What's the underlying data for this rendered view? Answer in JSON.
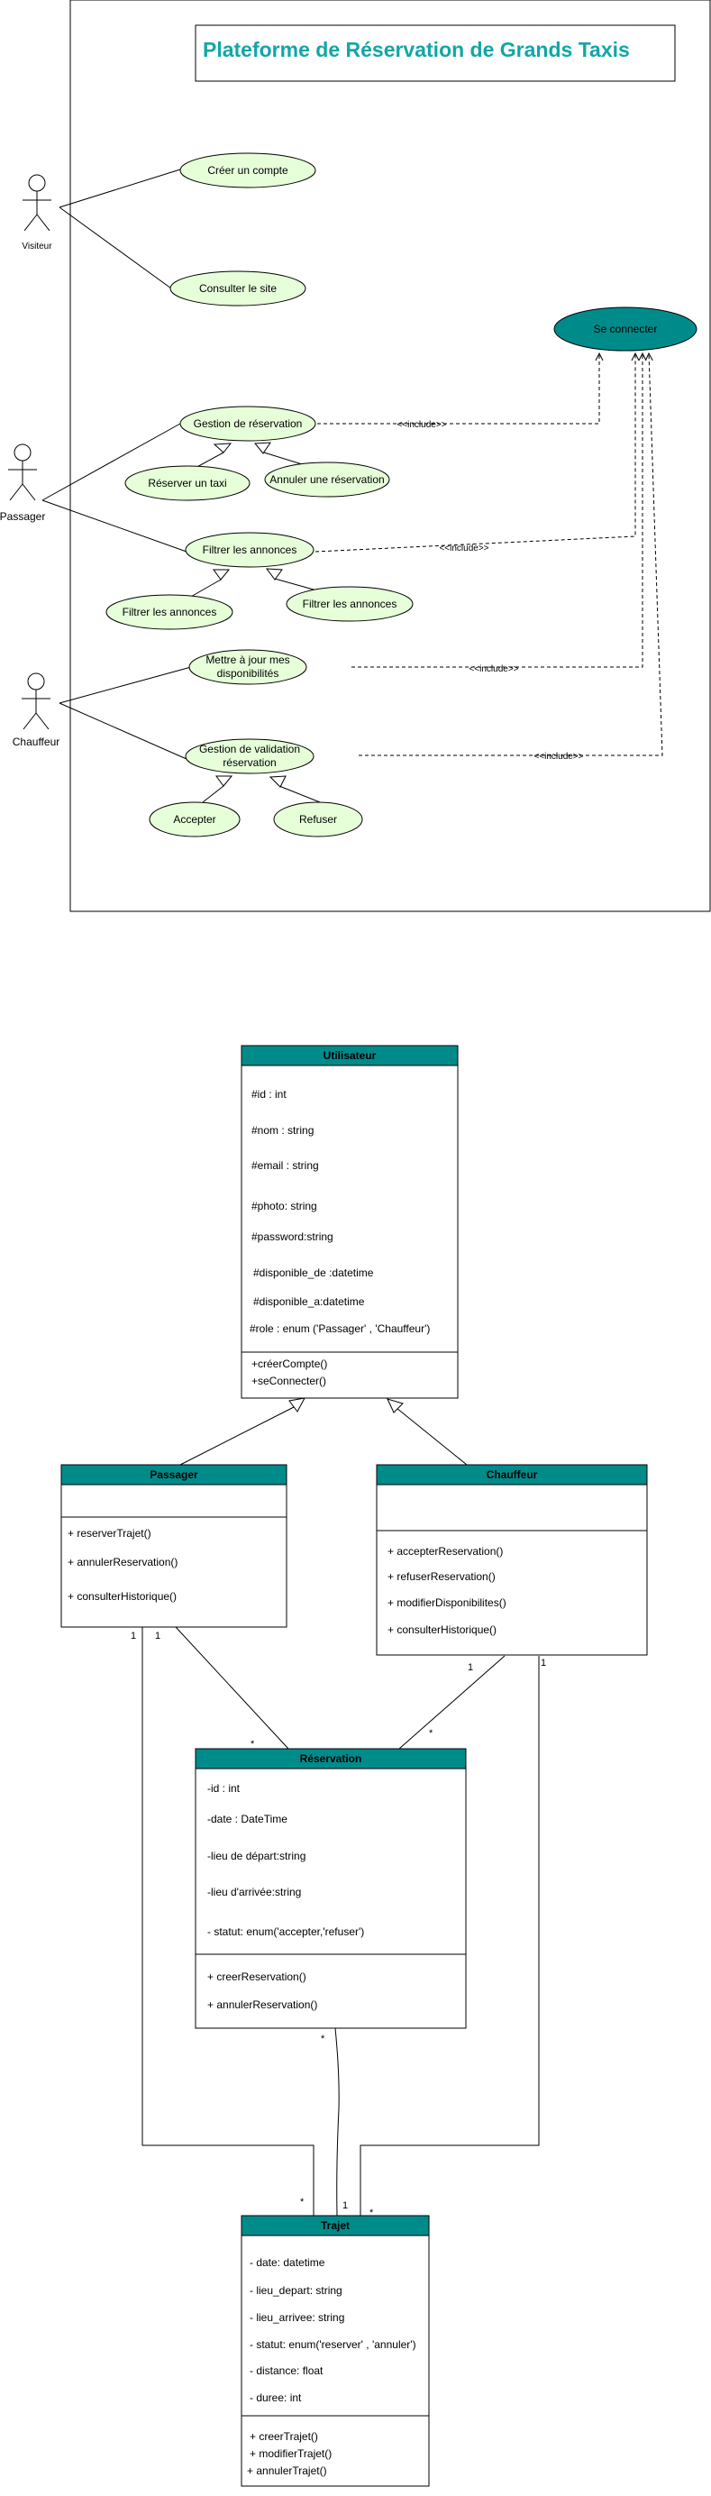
{
  "title": "Plateforme de Réservation de Grands Taxis",
  "colors": {
    "teal": "#008b8b",
    "usecase_fill": "#e6ffd9",
    "title_text": "#12a6a6"
  },
  "actors": {
    "visiteur": "Visiteur",
    "passager": "Passager",
    "chauffeur": "Chauffeur"
  },
  "usecases": {
    "creer_compte": "Créer un compte",
    "consulter_site": "Consulter le site",
    "se_connecter": "Se connecter",
    "gestion_reservation": "Gestion de  réservation",
    "reserver_taxi": "Réserver un taxi",
    "annuler_reservation": "Annuler une réservation",
    "filtrer_annonces_main": "Filtrer les annonces",
    "filtrer_annonces_left": "Filtrer les annonces",
    "filtrer_annonces_right": "Filtrer les annonces",
    "maj_dispo_1": "Mettre à jour mes",
    "maj_dispo_2": "disponibilités",
    "gestion_validation_1": "Gestion de  validation",
    "gestion_validation_2": "réservation",
    "accepter": "Accepter",
    "refuser": "Refuser"
  },
  "include_label": "<<include>>",
  "classes": {
    "utilisateur": {
      "name": "Utilisateur",
      "attributes": [
        "#id : int",
        "#nom : string",
        "#email : string",
        "#photo: string",
        "#password:string",
        "#disponible_de :datetime",
        "#disponible_a:datetime",
        "#role : enum ('Passager' , 'Chauffeur')"
      ],
      "methods": [
        "+créerCompte()",
        "+seConnecter()"
      ]
    },
    "passager": {
      "name": "Passager",
      "methods": [
        "+ reserverTrajet()",
        "+ annulerReservation()",
        "+ consulterHistorique()"
      ]
    },
    "chauffeur": {
      "name": "Chauffeur",
      "methods": [
        "+ accepterReservation()",
        "+ refuserReservation()",
        "+ modifierDisponibilites()",
        "+ consulterHistorique()"
      ]
    },
    "reservation": {
      "name": "Réservation",
      "attributes": [
        "-id : int",
        "-date : DateTime",
        "-lieu de départ:string",
        "-lieu d'arrivée:string",
        "- statut: enum('accepter,'refuser')"
      ],
      "methods": [
        "+ creerReservation()",
        "+ annulerReservation()"
      ]
    },
    "trajet": {
      "name": "Trajet",
      "attributes": [
        "- date: datetime",
        "- lieu_depart: string",
        "- lieu_arrivee: string",
        "- statut: enum('reserver' , 'annuler')",
        "- distance: float",
        "- duree: int"
      ],
      "methods": [
        "+ creerTrajet()",
        "+ modifierTrajet()",
        "+ annulerTrajet()"
      ]
    }
  },
  "multiplicities": {
    "pass_1a": "1",
    "pass_1b": "1",
    "pass_res": "*",
    "ch_1a": "1",
    "ch_1b": "1",
    "ch_res": "*",
    "res_traj": "*",
    "traj_1": "1",
    "traj_star_left": "*",
    "traj_star_right": "*"
  }
}
